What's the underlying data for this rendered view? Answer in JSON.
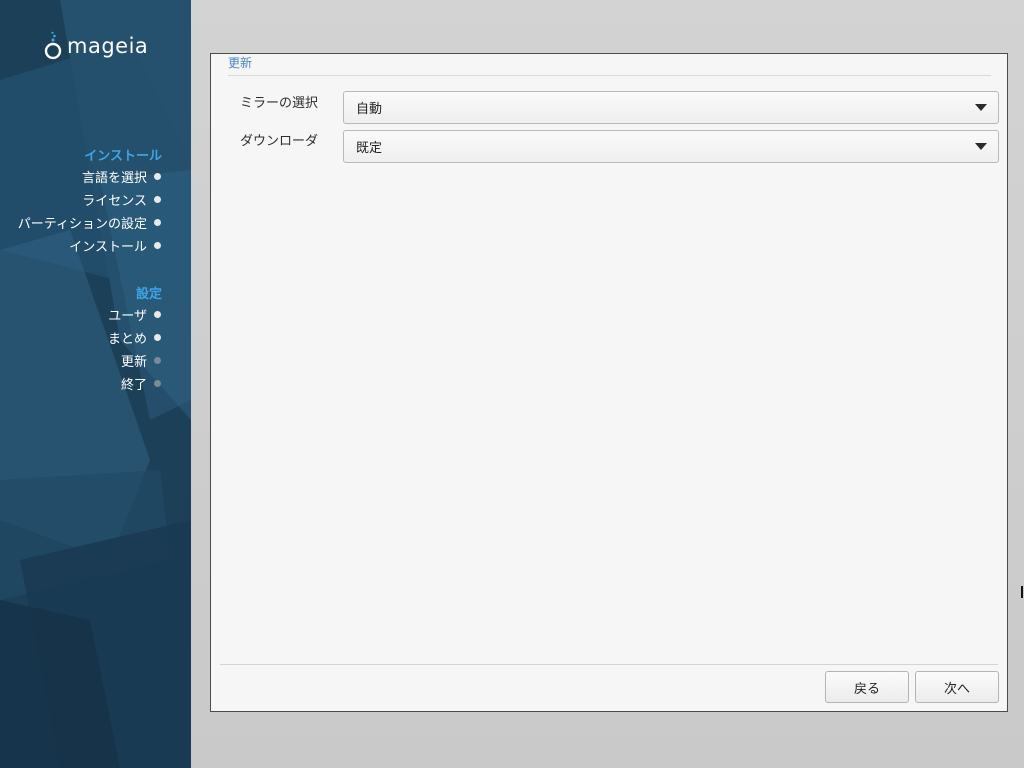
{
  "brand": {
    "name": "mageia"
  },
  "sidebar": {
    "groups": [
      {
        "heading": "インストール",
        "items": [
          {
            "label": "言語を選択",
            "state": "done"
          },
          {
            "label": "ライセンス",
            "state": "done"
          },
          {
            "label": "パーティションの設定",
            "state": "done"
          },
          {
            "label": "インストール",
            "state": "done"
          }
        ]
      },
      {
        "heading": "設定",
        "items": [
          {
            "label": "ユーザ",
            "state": "done"
          },
          {
            "label": "まとめ",
            "state": "done"
          },
          {
            "label": "更新",
            "state": "current"
          },
          {
            "label": "終了",
            "state": "pending"
          }
        ]
      }
    ]
  },
  "panel": {
    "title": "更新",
    "mirror": {
      "label": "ミラーの選択",
      "value": "自動"
    },
    "downloader": {
      "label": "ダウンローダ",
      "value": "既定"
    },
    "buttons": {
      "back": "戻る",
      "next": "次へ"
    }
  },
  "colors": {
    "sidebar_bg": "#1b3c56",
    "heading_accent": "#3ea5e8",
    "panel_title": "#4a86c5"
  }
}
